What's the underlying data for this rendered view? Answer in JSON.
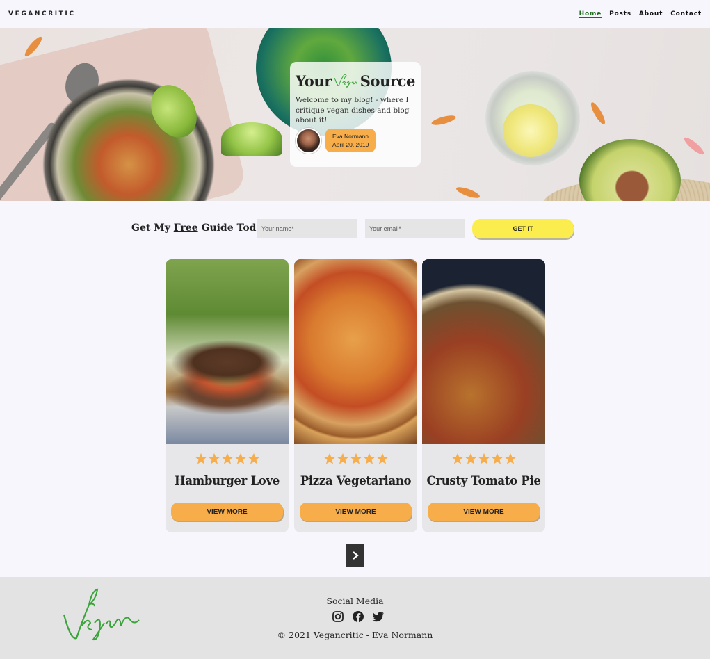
{
  "nav": {
    "brand": "VEGANCRITIC",
    "links": [
      "Home",
      "Posts",
      "About",
      "Contact"
    ]
  },
  "hero": {
    "title_before": "Your",
    "title_script": "Vegan",
    "title_after": "Source",
    "text": "Welcome to my blog! - where I critique vegan dishes and blog about it!",
    "author_name": "Eva Normann",
    "author_date": "April 20, 2019"
  },
  "newsletter": {
    "label_before": "Get My ",
    "label_link": "Free",
    "label_after": " Guide Today!",
    "name_placeholder": "Your name*",
    "email_placeholder": "Your email*",
    "button": "GET IT"
  },
  "cards": [
    {
      "title": "Hamburger Love",
      "rating": 5,
      "button": "VIEW MORE"
    },
    {
      "title": "Pizza Vegetariano",
      "rating": 5,
      "button": "VIEW MORE"
    },
    {
      "title": "Crusty Tomato Pie",
      "rating": 5,
      "button": "VIEW MORE"
    }
  ],
  "pager": {
    "icon": "chevron-right-icon"
  },
  "footer": {
    "logo_text": "Vegan",
    "social_title": "Social Media",
    "icons": [
      "instagram-icon",
      "facebook-icon",
      "twitter-icon"
    ],
    "copyright": "© 2021 Vegancritic - Eva Normann"
  },
  "colors": {
    "accent_orange": "#f7ae4a",
    "accent_yellow": "#fbed4d",
    "brand_green": "#3aa43a",
    "background": "#f7f6fd",
    "footer_bg": "#e3e3e3"
  }
}
